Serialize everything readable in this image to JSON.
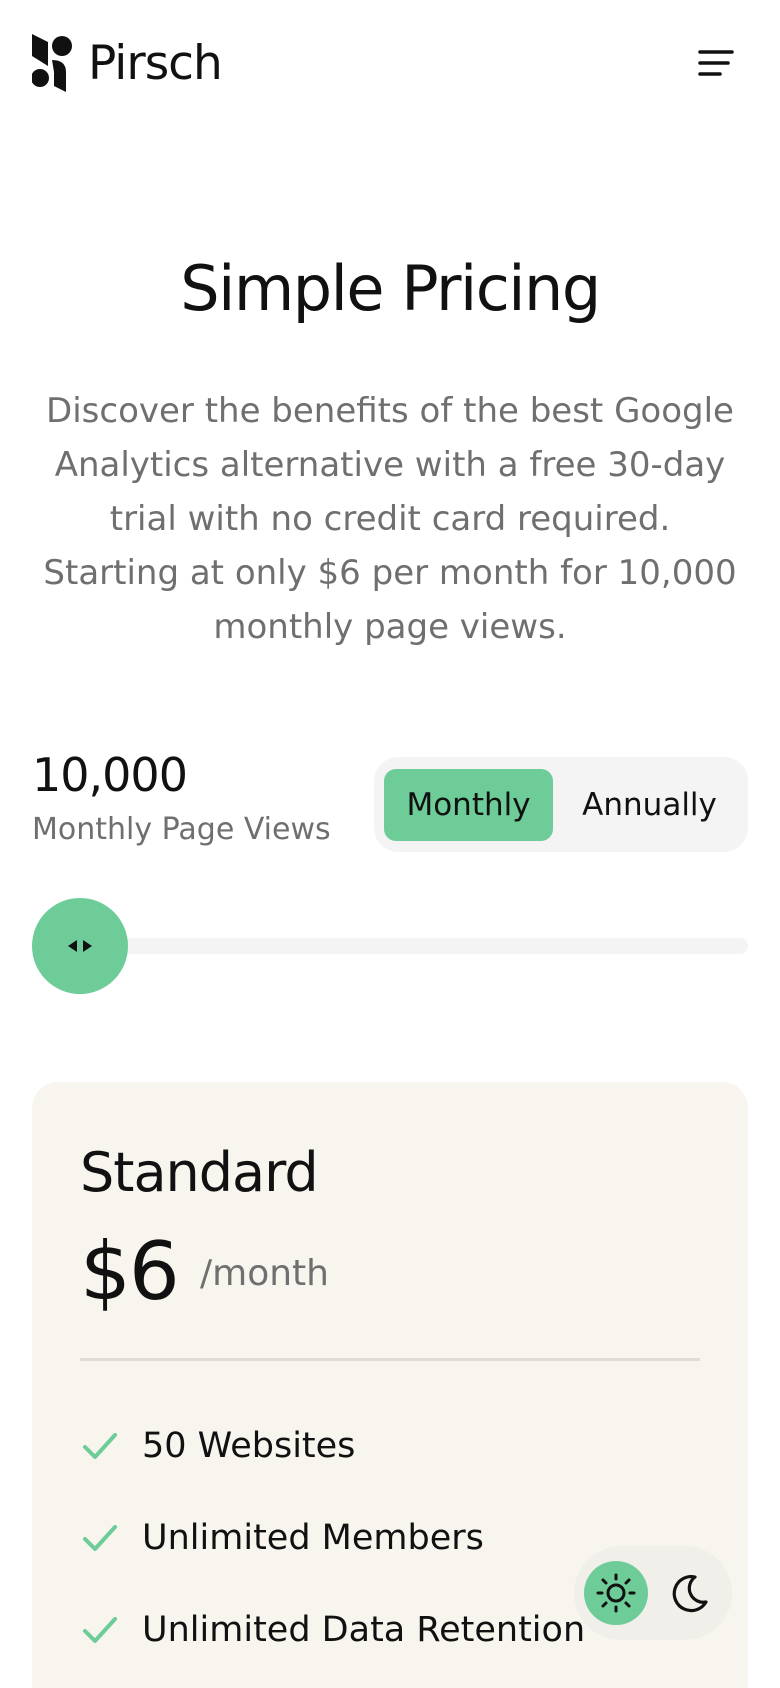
{
  "header": {
    "brand": "Pirsch",
    "menu_icon": "menu-icon"
  },
  "hero": {
    "title": "Simple Pricing",
    "description": "Discover the benefits of the best Google Analytics alternative with a free 30-day trial with no credit card required. Starting at only $6 per month for 10,000 monthly page views."
  },
  "pricing_controls": {
    "page_views": "10,000",
    "page_views_label": "Monthly Page Views",
    "billing_options": [
      "Monthly",
      "Annually"
    ],
    "selected_billing": "Monthly",
    "slider_level": 0
  },
  "plan": {
    "name": "Standard",
    "price": "$6",
    "period": "/month",
    "features": [
      "50 Websites",
      "Unlimited Members",
      "Unlimited Data Retention"
    ]
  },
  "theme": {
    "active": "light",
    "icons": [
      "sun-icon",
      "moon-icon"
    ]
  },
  "colors": {
    "accent": "#6dcc98",
    "card_background": "#f7f5ee",
    "muted_text": "#6f6f6f"
  }
}
